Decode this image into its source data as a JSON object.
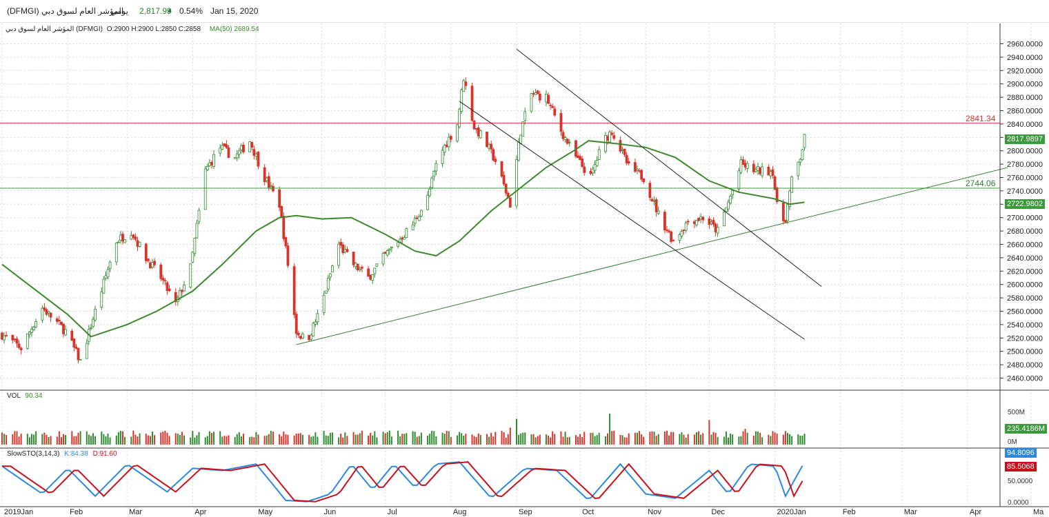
{
  "header": {
    "symbol_name": "المؤشر العام لسوق دبي (DFMGI)",
    "period": "يومي",
    "last": "2,817.99",
    "change_pct": "0.54%",
    "date": "Jan 15, 2020",
    "up_arrow_color": "#2e7d32"
  },
  "ohlc_line": {
    "name": "المؤشر العام لسوق دبي (DFMGI)",
    "o": "O:2900",
    "h": "H:2900",
    "l": "L:2850",
    "c": "C:2858",
    "ma_label": "MA(50)",
    "ma_value": "2689.54"
  },
  "price_labels": {
    "resistance": "2841.34",
    "support": "2744.06",
    "last_price": "2817.9897",
    "ma_last": "2722.9802"
  },
  "vol_panel": {
    "label": "VOL",
    "value": "90.34",
    "tick_high": "500M",
    "tick_low": "0M",
    "last": "235.4186M"
  },
  "stoch_panel": {
    "label": "SlowSTO(3,14,3)",
    "k": "K:84.38",
    "d": "D:91.60",
    "tick_mid": "50.0000",
    "tick_low": "0.0000",
    "k_last": "94.8096",
    "d_last": "85.5068"
  },
  "colors": {
    "up": "#2e8b2e",
    "down": "#d9342b",
    "ma": "#3a8a2a",
    "resistance": "#e23c3c",
    "support": "#3a9a3a",
    "trend": "#2f7f2f",
    "channel": "#222222",
    "k_line": "#2a88e0",
    "d_line": "#c8101a"
  },
  "chart_data": {
    "type": "candlestick",
    "yaxis": {
      "min": 2460,
      "max": 2960,
      "step": 20
    },
    "y_ticks": [
      "2460.0000",
      "2480.0000",
      "2500.0000",
      "2520.0000",
      "2540.0000",
      "2560.0000",
      "2580.0000",
      "2600.0000",
      "2620.0000",
      "2640.0000",
      "2660.0000",
      "2680.0000",
      "2700.0000",
      "2720.0000",
      "2740.0000",
      "2760.0000",
      "2780.0000",
      "2800.0000",
      "2820.0000",
      "2840.0000",
      "2860.0000",
      "2880.0000",
      "2900.0000",
      "2920.0000",
      "2940.0000",
      "2960.0000"
    ],
    "x_labels": [
      "2019Jan",
      "Feb",
      "Mar",
      "Apr",
      "May",
      "Jun",
      "Jul",
      "Aug",
      "Sep",
      "Oct",
      "Nov",
      "Dec",
      "2020Jan",
      "Feb",
      "Mar",
      "Apr",
      "Ma"
    ],
    "horizontal_lines": [
      2841.34,
      2744.06
    ],
    "close_anchors": [
      [
        "2019-01-01",
        2525
      ],
      [
        "2019-01-10",
        2505
      ],
      [
        "2019-01-20",
        2565
      ],
      [
        "2019-01-31",
        2530
      ],
      [
        "2019-02-07",
        2485
      ],
      [
        "2019-02-14",
        2560
      ],
      [
        "2019-02-24",
        2665
      ],
      [
        "2019-03-03",
        2680
      ],
      [
        "2019-03-10",
        2640
      ],
      [
        "2019-03-17",
        2610
      ],
      [
        "2019-03-24",
        2570
      ],
      [
        "2019-03-31",
        2625
      ],
      [
        "2019-04-07",
        2770
      ],
      [
        "2019-04-14",
        2805
      ],
      [
        "2019-04-21",
        2790
      ],
      [
        "2019-04-28",
        2815
      ],
      [
        "2019-05-05",
        2760
      ],
      [
        "2019-05-12",
        2720
      ],
      [
        "2019-05-16",
        2630
      ],
      [
        "2019-05-20",
        2530
      ],
      [
        "2019-05-25",
        2515
      ],
      [
        "2019-05-31",
        2560
      ],
      [
        "2019-06-09",
        2660
      ],
      [
        "2019-06-16",
        2630
      ],
      [
        "2019-06-23",
        2610
      ],
      [
        "2019-06-30",
        2640
      ],
      [
        "2019-07-07",
        2665
      ],
      [
        "2019-07-14",
        2690
      ],
      [
        "2019-07-21",
        2730
      ],
      [
        "2019-07-26",
        2790
      ],
      [
        "2019-08-04",
        2840
      ],
      [
        "2019-08-07",
        2910
      ],
      [
        "2019-08-12",
        2835
      ],
      [
        "2019-08-16",
        2820
      ],
      [
        "2019-08-22",
        2785
      ],
      [
        "2019-08-29",
        2720
      ],
      [
        "2019-09-03",
        2830
      ],
      [
        "2019-09-08",
        2885
      ],
      [
        "2019-09-15",
        2880
      ],
      [
        "2019-09-22",
        2830
      ],
      [
        "2019-09-29",
        2790
      ],
      [
        "2019-10-06",
        2760
      ],
      [
        "2019-10-12",
        2815
      ],
      [
        "2019-10-16",
        2830
      ],
      [
        "2019-10-24",
        2775
      ],
      [
        "2019-10-31",
        2760
      ],
      [
        "2019-11-07",
        2705
      ],
      [
        "2019-11-14",
        2665
      ],
      [
        "2019-11-21",
        2695
      ],
      [
        "2019-11-28",
        2700
      ],
      [
        "2019-12-05",
        2680
      ],
      [
        "2019-12-12",
        2740
      ],
      [
        "2019-12-16",
        2780
      ],
      [
        "2019-12-23",
        2770
      ],
      [
        "2019-12-31",
        2770
      ],
      [
        "2020-01-03",
        2690
      ],
      [
        "2020-01-06",
        2700
      ],
      [
        "2020-01-09",
        2755
      ],
      [
        "2020-01-13",
        2790
      ],
      [
        "2020-01-15",
        2818
      ]
    ],
    "ma50": [
      [
        "2019-01-01",
        2630
      ],
      [
        "2019-02-01",
        2555
      ],
      [
        "2019-02-12",
        2522
      ],
      [
        "2019-03-01",
        2540
      ],
      [
        "2019-03-15",
        2560
      ],
      [
        "2019-04-01",
        2590
      ],
      [
        "2019-04-15",
        2630
      ],
      [
        "2019-05-01",
        2680
      ],
      [
        "2019-05-12",
        2700
      ],
      [
        "2019-05-20",
        2703
      ],
      [
        "2019-06-01",
        2698
      ],
      [
        "2019-06-15",
        2700
      ],
      [
        "2019-07-01",
        2675
      ],
      [
        "2019-07-15",
        2650
      ],
      [
        "2019-07-25",
        2643
      ],
      [
        "2019-08-05",
        2665
      ],
      [
        "2019-08-20",
        2710
      ],
      [
        "2019-09-01",
        2740
      ],
      [
        "2019-09-15",
        2775
      ],
      [
        "2019-09-28",
        2800
      ],
      [
        "2019-10-05",
        2815
      ],
      [
        "2019-10-20",
        2810
      ],
      [
        "2019-11-01",
        2805
      ],
      [
        "2019-11-15",
        2790
      ],
      [
        "2019-12-01",
        2755
      ],
      [
        "2019-12-15",
        2738
      ],
      [
        "2020-01-01",
        2728
      ],
      [
        "2020-01-08",
        2720
      ],
      [
        "2020-01-15",
        2723
      ]
    ],
    "trendline": [
      [
        "2019-05-20",
        2510
      ],
      [
        "2020-04-20",
        2775
      ]
    ],
    "channel_upper": [
      [
        "2019-09-01",
        2952
      ],
      [
        "2020-01-23",
        2597
      ]
    ],
    "channel_lower": [
      [
        "2019-08-05",
        2874
      ],
      [
        "2020-01-15",
        2518
      ]
    ],
    "volume_range": [
      0,
      600
    ],
    "volume_spikes": [
      [
        "2019-04-26",
        360
      ],
      [
        "2019-09-01",
        440
      ],
      [
        "2019-10-15",
        530
      ],
      [
        "2019-12-01",
        420
      ],
      [
        "2019-08-29",
        290
      ],
      [
        "2019-12-18",
        270
      ]
    ],
    "stochastic": {
      "range": [
        0,
        100
      ],
      "k_anchors": [
        [
          "2019-01-01",
          85
        ],
        [
          "2019-01-20",
          20
        ],
        [
          "2019-02-01",
          80
        ],
        [
          "2019-02-14",
          15
        ],
        [
          "2019-03-01",
          90
        ],
        [
          "2019-03-20",
          25
        ],
        [
          "2019-04-01",
          80
        ],
        [
          "2019-04-15",
          75
        ],
        [
          "2019-05-01",
          90
        ],
        [
          "2019-05-15",
          5
        ],
        [
          "2019-05-25",
          2
        ],
        [
          "2019-06-05",
          20
        ],
        [
          "2019-06-15",
          90
        ],
        [
          "2019-06-25",
          30
        ],
        [
          "2019-07-05",
          90
        ],
        [
          "2019-07-15",
          35
        ],
        [
          "2019-07-25",
          90
        ],
        [
          "2019-08-05",
          95
        ],
        [
          "2019-08-20",
          10
        ],
        [
          "2019-09-05",
          80
        ],
        [
          "2019-09-20",
          75
        ],
        [
          "2019-10-05",
          5
        ],
        [
          "2019-10-20",
          90
        ],
        [
          "2019-11-01",
          20
        ],
        [
          "2019-11-15",
          10
        ],
        [
          "2019-12-01",
          75
        ],
        [
          "2019-12-10",
          20
        ],
        [
          "2019-12-20",
          90
        ],
        [
          "2020-01-01",
          85
        ],
        [
          "2020-01-06",
          15
        ],
        [
          "2020-01-15",
          95
        ]
      ]
    }
  }
}
